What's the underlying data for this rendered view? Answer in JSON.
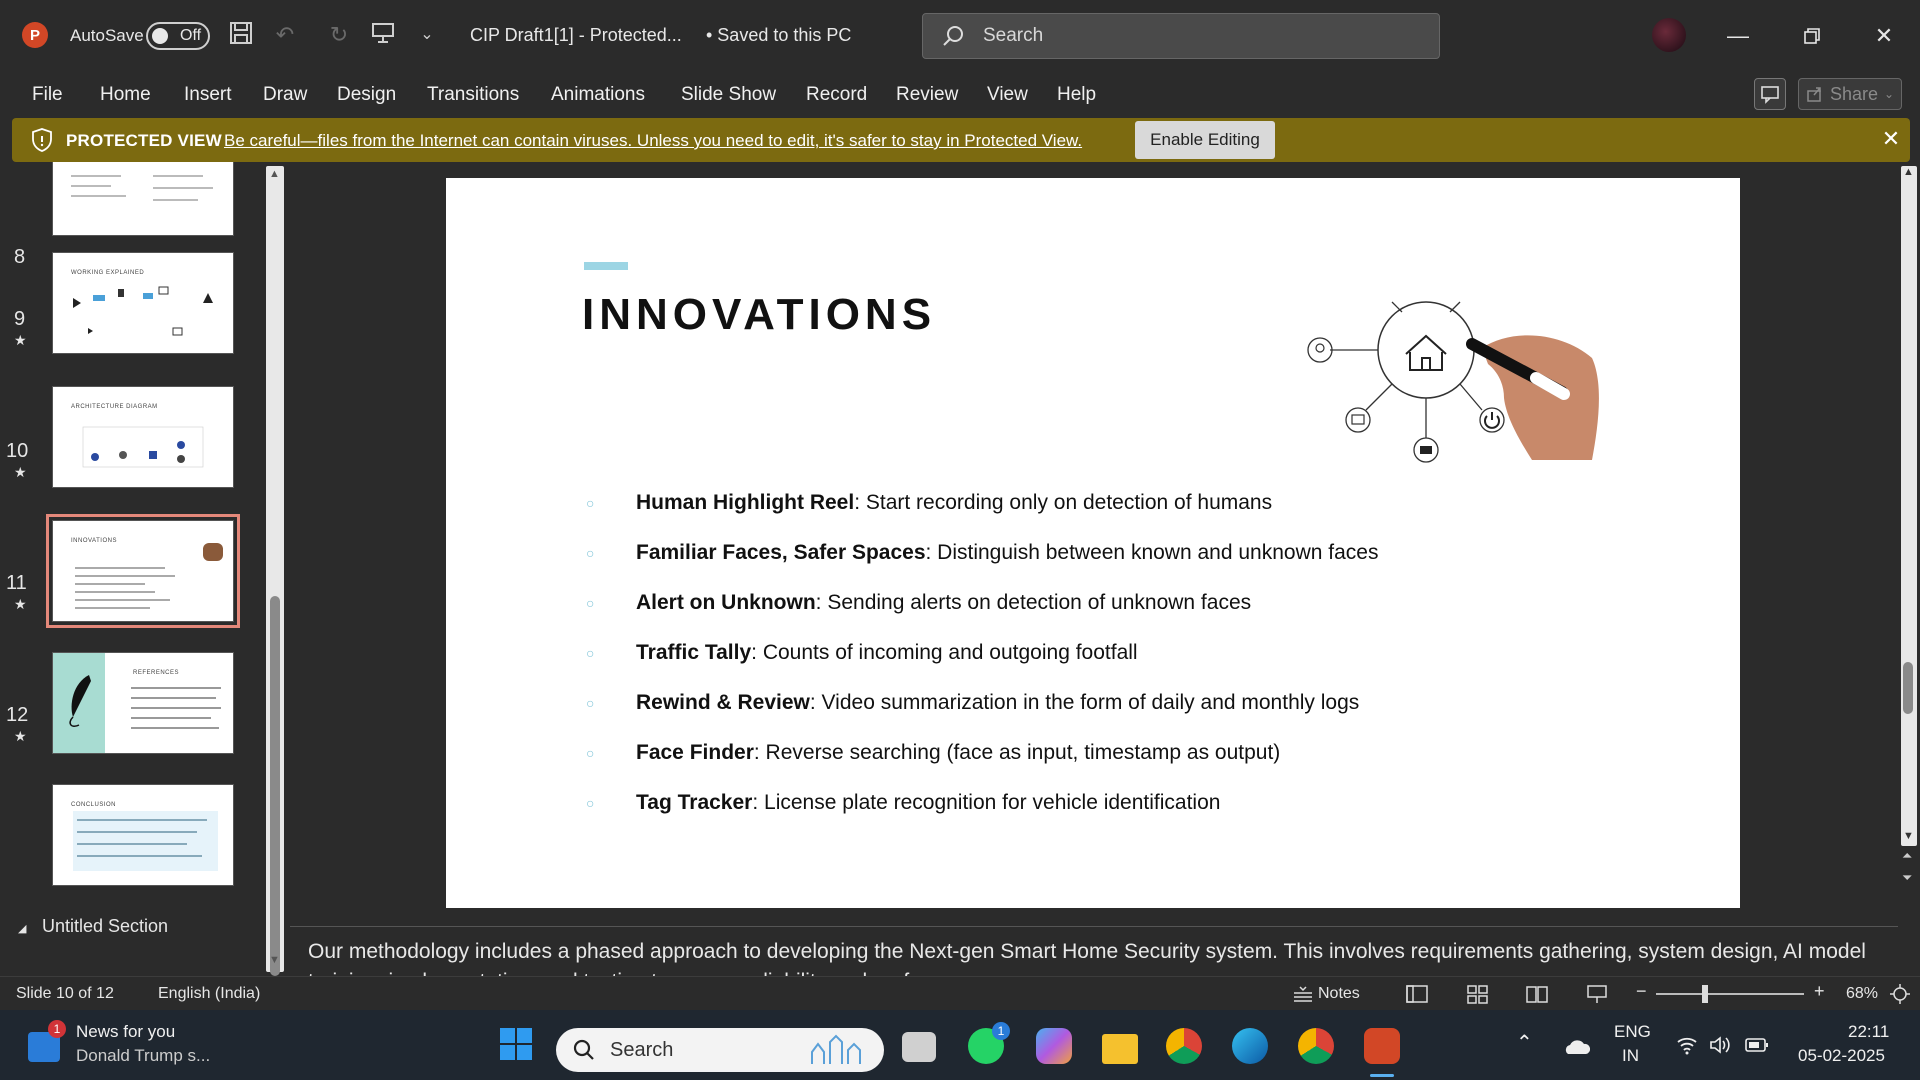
{
  "titlebar": {
    "app_letter": "P",
    "autosave_label": "AutoSave",
    "autosave_state": "Off",
    "doc_title": "CIP Draft1[1]  -  Protected...",
    "save_status": "•  Saved to this PC",
    "search_placeholder": "Search"
  },
  "ribbon": {
    "tabs": [
      "File",
      "Home",
      "Insert",
      "Draw",
      "Design",
      "Transitions",
      "Animations",
      "Slide Show",
      "Record",
      "Review",
      "View",
      "Help"
    ],
    "share_label": "Share"
  },
  "protected_view": {
    "title": "PROTECTED VIEW",
    "message": "Be careful—files from the Internet can contain viruses. Unless you need to edit, it's safer to stay in Protected View.",
    "enable_button": "Enable Editing"
  },
  "thumbnails": {
    "slides": [
      {
        "number": "8",
        "title": "WORKING EXPLAINED",
        "starred": false
      },
      {
        "number": "9",
        "title": "ARCHITECTURE DIAGRAM",
        "starred": true
      },
      {
        "number": "10",
        "title": "INNOVATIONS",
        "starred": true
      },
      {
        "number": "11",
        "title": "REFERENCES",
        "starred": true
      },
      {
        "number": "12",
        "title": "CONCLUSION",
        "starred": true
      }
    ],
    "section_label": "Untitled Section"
  },
  "slide": {
    "title": "INNOVATIONS",
    "bullets": [
      {
        "bold": "Human Highlight Reel",
        "text": ": Start recording only on detection of humans"
      },
      {
        "bold": "Familiar Faces, Safer Spaces",
        "text": ": Distinguish between known and unknown faces"
      },
      {
        "bold": "Alert on Unknown",
        "text": ": Sending alerts on detection of unknown faces"
      },
      {
        "bold": "Traffic Tally",
        "text": ": Counts of incoming and outgoing footfall"
      },
      {
        "bold": "Rewind & Review",
        "text": ": Video summarization in the form of daily and monthly logs"
      },
      {
        "bold": "Face Finder",
        "text": ": Reverse searching (face as input, timestamp as output)"
      },
      {
        "bold": "Tag Tracker",
        "text": ": License plate recognition for vehicle identification"
      }
    ]
  },
  "notes": {
    "text": "Our methodology includes a phased approach to developing the Next-gen Smart Home Security system. This involves requirements gathering, system design, AI model training, implementation, and testing to ensure reliability and performance."
  },
  "statusbar": {
    "slide_info": "Slide 10 of 12",
    "language": "English (India)",
    "notes_label": "Notes",
    "zoom": "68%"
  },
  "taskbar": {
    "news_title": "News for you",
    "news_sub": "Donald Trump s...",
    "news_badge": "1",
    "search_placeholder": "Search",
    "whatsapp_badge": "1",
    "lang_line1": "ENG",
    "lang_line2": "IN",
    "time": "22:11",
    "date": "05-02-2025"
  },
  "colors": {
    "accent_bar": "#9cd5e4",
    "protected_bar": "#7c6a10",
    "powerpoint": "#d24726",
    "selected_outline": "#e4887a"
  }
}
